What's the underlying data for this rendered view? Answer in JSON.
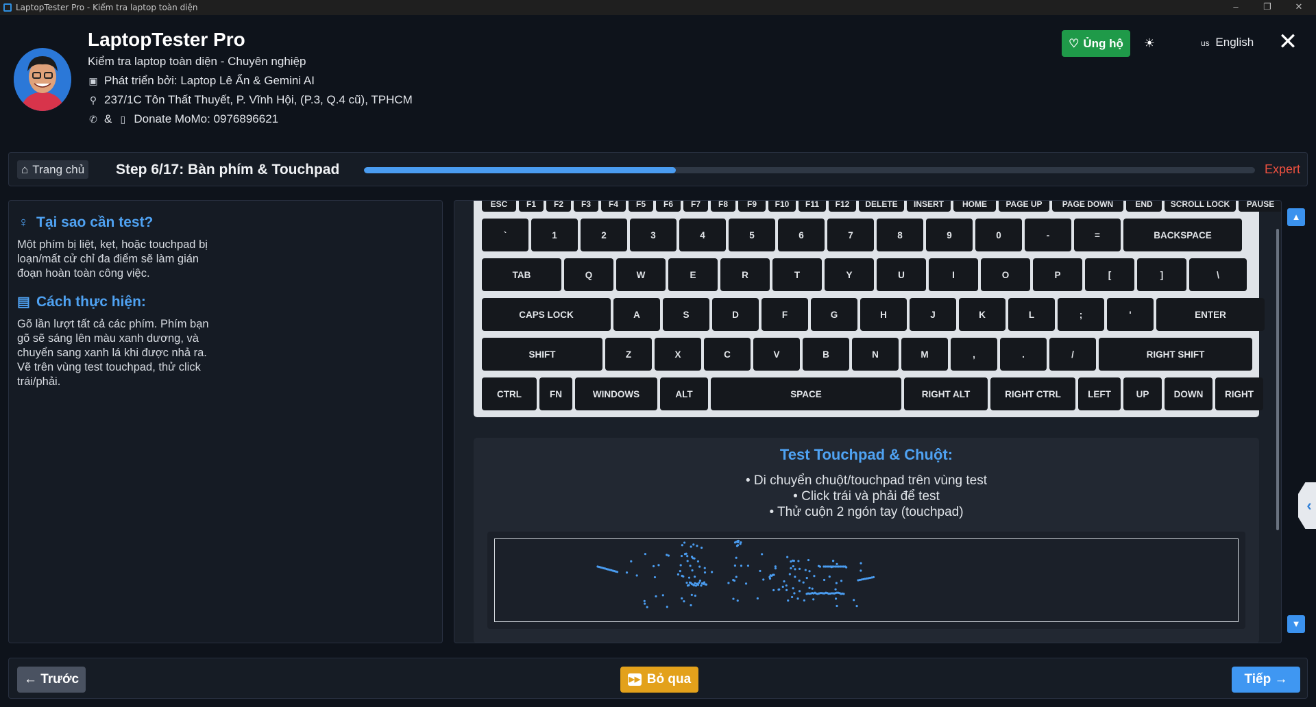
{
  "window": {
    "title": "LaptopTester Pro - Kiểm tra laptop toàn diện",
    "minimize": "–",
    "maximize": "❐",
    "close": "✕"
  },
  "header": {
    "app_name": "LaptopTester Pro",
    "subtitle": "Kiểm tra laptop toàn diện - Chuyên nghiệp",
    "developer": "Phát triển bởi: Laptop Lê Ẩn & Gemini AI",
    "address": "237/1C Tôn Thất Thuyết, P. Vĩnh Hội, (P.3, Q.4 cũ), TPHCM",
    "contact_sep": "&",
    "donate_line": "Donate MoMo: 0976896621",
    "donate_button": "Ủng hộ",
    "language_flag": "us",
    "language": "English"
  },
  "stepbar": {
    "home": "Trang chủ",
    "step_title": "Step 6/17: Bàn phím & Touchpad",
    "progress": 0.35,
    "level": "Expert"
  },
  "left": {
    "why_title": "Tại sao cần test?",
    "why_text": "Một phím bị liệt, kẹt, hoặc touchpad bị loạn/mất cử chỉ đa điểm sẽ làm gián đoạn hoàn toàn công việc.",
    "how_title": "Cách thực hiện:",
    "how_text": "Gõ lần lượt tất cả các phím. Phím bạn gõ sẽ sáng lên màu xanh dương, và chuyển sang xanh lá khi được nhả ra. Vẽ trên vùng test touchpad, thử click trái/phải."
  },
  "keyboard": {
    "frow": [
      "ESC",
      "F1",
      "F2",
      "F3",
      "F4",
      "F5",
      "F6",
      "F7",
      "F8",
      "F9",
      "F10",
      "F11",
      "F12",
      "DELETE",
      "INSERT",
      "HOME",
      "PAGE UP",
      "PAGE DOWN",
      "END",
      "SCROLL LOCK",
      "PAUSE"
    ],
    "row1": [
      "`",
      "1",
      "2",
      "3",
      "4",
      "5",
      "6",
      "7",
      "8",
      "9",
      "0",
      "-",
      "=",
      "BACKSPACE"
    ],
    "row2": [
      "TAB",
      "Q",
      "W",
      "E",
      "R",
      "T",
      "Y",
      "U",
      "I",
      "O",
      "P",
      "[",
      "]",
      "\\"
    ],
    "row3": [
      "CAPS LOCK",
      "A",
      "S",
      "D",
      "F",
      "G",
      "H",
      "J",
      "K",
      "L",
      ";",
      "'",
      "ENTER"
    ],
    "row4": [
      "SHIFT",
      "Z",
      "X",
      "C",
      "V",
      "B",
      "N",
      "M",
      ",",
      ".",
      "/",
      "RIGHT SHIFT"
    ],
    "row5": [
      "CTRL",
      "FN",
      "WINDOWS",
      "ALT",
      "SPACE",
      "RIGHT ALT",
      "RIGHT CTRL",
      "LEFT",
      "UP",
      "DOWN",
      "RIGHT"
    ]
  },
  "touchpad": {
    "title": "Test Touchpad & Chuột:",
    "line1": "• Di chuyển chuột/touchpad trên vùng test",
    "line2": "• Click trái và phải để test",
    "line3": "• Thử cuộn 2 ngón tay (touchpad)",
    "trail_color": "#4a9cf0"
  },
  "footer": {
    "prev": "← Trước",
    "skip": "Bỏ qua",
    "next": "Tiếp →"
  },
  "colors": {
    "accent": "#4fa2f2",
    "donate": "#1f9a49",
    "skip": "#e3a11b",
    "next": "#3f97f2",
    "expert": "#ef5140"
  }
}
